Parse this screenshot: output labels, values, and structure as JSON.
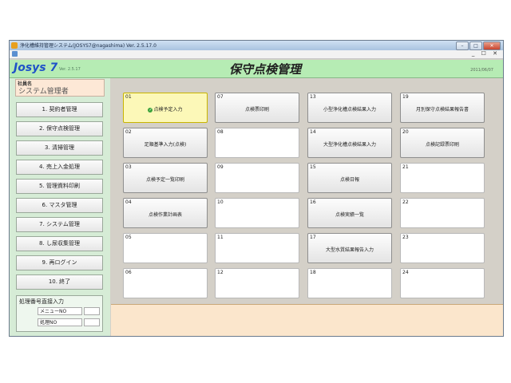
{
  "window": {
    "title": "浄化槽維持管理システム(JOSYS7@nagashima) Ver. 2.5.17.0",
    "controls": {
      "minimize": "–",
      "maximize": "□",
      "close": "✕"
    },
    "menu_controls": "_ ☐ ✕"
  },
  "header": {
    "logo": "Josys 7",
    "logo_version": "Ver. 2.5.17",
    "page_title": "保守点検管理",
    "date": "2011/06/07"
  },
  "user": {
    "label": "社員名",
    "name": "システム管理者"
  },
  "sidebar": {
    "items": [
      {
        "label": "1. 契約者管理"
      },
      {
        "label": "2. 保守点検管理"
      },
      {
        "label": "3. 清掃管理"
      },
      {
        "label": "4. 売上入金処理"
      },
      {
        "label": "5. 管理資料印刷"
      },
      {
        "label": "6. マスタ管理"
      },
      {
        "label": "7. システム管理"
      },
      {
        "label": "8. し尿収集管理"
      },
      {
        "label": "9. 再ログイン"
      },
      {
        "label": "10. 終了"
      }
    ],
    "direct": {
      "title": "処理番号直接入力",
      "menu_no_label": "メニューNO",
      "process_no_label": "処理NO"
    }
  },
  "tiles": [
    {
      "num": "01",
      "label": "点検予定入力",
      "selected": true
    },
    {
      "num": "02",
      "label": "足順基準入力(点検)"
    },
    {
      "num": "03",
      "label": "点検予定一覧印刷"
    },
    {
      "num": "04",
      "label": "点検作業計画表"
    },
    {
      "num": "05",
      "label": ""
    },
    {
      "num": "06",
      "label": ""
    },
    {
      "num": "07",
      "label": "点検票印刷"
    },
    {
      "num": "08",
      "label": ""
    },
    {
      "num": "09",
      "label": ""
    },
    {
      "num": "10",
      "label": ""
    },
    {
      "num": "11",
      "label": ""
    },
    {
      "num": "12",
      "label": ""
    },
    {
      "num": "13",
      "label": "小型浄化槽点検結果入力"
    },
    {
      "num": "14",
      "label": "大型浄化槽点検結果入力"
    },
    {
      "num": "15",
      "label": "点検日報"
    },
    {
      "num": "16",
      "label": "点検実績一覧"
    },
    {
      "num": "17",
      "label": "大型水質結果報告入力"
    },
    {
      "num": "18",
      "label": ""
    },
    {
      "num": "19",
      "label": "月別保守点検結果報告書"
    },
    {
      "num": "20",
      "label": "点検記録票印刷"
    },
    {
      "num": "21",
      "label": ""
    },
    {
      "num": "22",
      "label": ""
    },
    {
      "num": "23",
      "label": ""
    },
    {
      "num": "24",
      "label": ""
    }
  ],
  "colors": {
    "header_green": "#b6ecb4",
    "sidebar_green": "#d6ecd6",
    "selected_tile": "#fcf8b8",
    "footer": "#fbe6cc",
    "logo_blue": "#1f52c8"
  }
}
